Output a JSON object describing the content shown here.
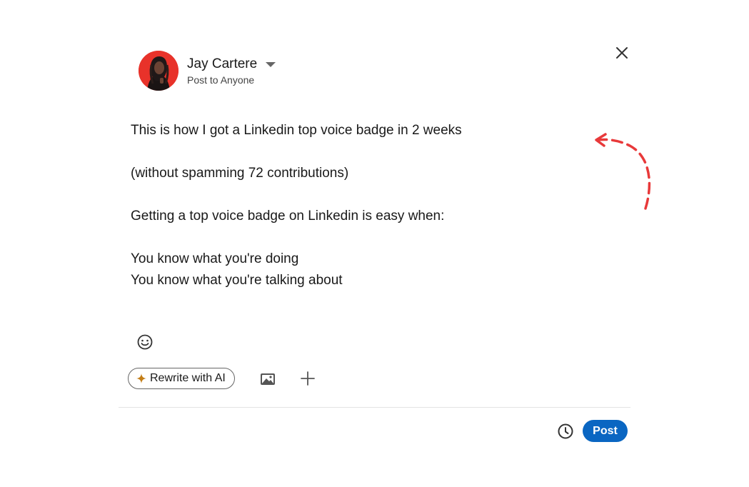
{
  "author": {
    "name": "Jay Cartere",
    "audience": "Post to Anyone"
  },
  "editor": {
    "lines": [
      "This is how I got a Linkedin top voice badge in 2 weeks",
      "",
      "(without spamming 72 contributions)",
      "",
      "Getting a top voice badge on Linkedin is easy when:",
      "",
      "You know what you're doing",
      "You know what you're talking about"
    ]
  },
  "toolbar": {
    "rewrite_label": "Rewrite with AI"
  },
  "footer": {
    "post_label": "Post"
  },
  "colors": {
    "primary": "#0a66c2",
    "annotation_arrow": "#e8393a",
    "ai_spark": "#c37d16",
    "avatar_bg": "#e8322a"
  },
  "icons": {
    "close": "close-icon",
    "caret": "caret-down-icon",
    "emoji": "emoji-icon",
    "spark": "sparkle-icon",
    "media": "image-icon",
    "more": "plus-icon",
    "schedule": "clock-icon"
  }
}
